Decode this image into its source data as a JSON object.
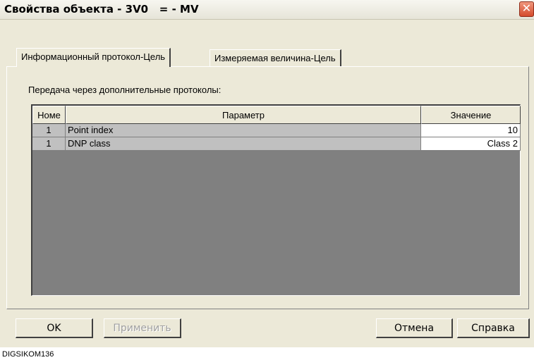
{
  "window": {
    "title": "Свойства объекта - 3V0   = - MV",
    "close_glyph": "✕"
  },
  "tabs": [
    {
      "label": "Информационный протокол-Цель",
      "active": true
    },
    {
      "label": "Измеряемая величина-Цель",
      "active": false
    }
  ],
  "section_label": "Передача через дополнительные протоколы:",
  "table": {
    "columns": [
      "Номе",
      "Параметр",
      "Значение"
    ],
    "rows": [
      {
        "number": "1",
        "parameter": "Point index",
        "value": "10"
      },
      {
        "number": "1",
        "parameter": "DNP class",
        "value": "Class 2"
      }
    ]
  },
  "buttons": {
    "ok": "OK",
    "apply": "Применить",
    "cancel": "Отмена",
    "help": "Справка"
  },
  "caption": "DIGSIKOM136",
  "colors": {
    "dialog_bg": "#ece9d8",
    "grid_bg": "#808080",
    "row_bg": "#c0c0c0",
    "value_bg": "#ffffff",
    "close_button": "#d44a2c"
  }
}
